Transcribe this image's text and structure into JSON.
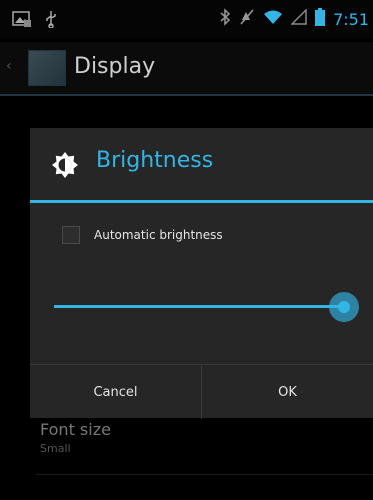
{
  "status_bar": {
    "time": "7:51",
    "icons": [
      "image-notification-icon",
      "usb-icon",
      "bluetooth-icon",
      "silent-icon",
      "wifi-icon",
      "signal-icon",
      "battery-icon"
    ]
  },
  "action_bar": {
    "title": "Display"
  },
  "background_prefs": {
    "font_size_title": "Font size",
    "font_size_value": "Small"
  },
  "dialog": {
    "title": "Brightness",
    "automatic_label": "Automatic brightness",
    "automatic_checked": false,
    "brightness_level": 1.0,
    "cancel_label": "Cancel",
    "ok_label": "OK"
  },
  "colors": {
    "accent": "#33b5e5",
    "dialog_bg": "#262626",
    "background": "#000000"
  }
}
